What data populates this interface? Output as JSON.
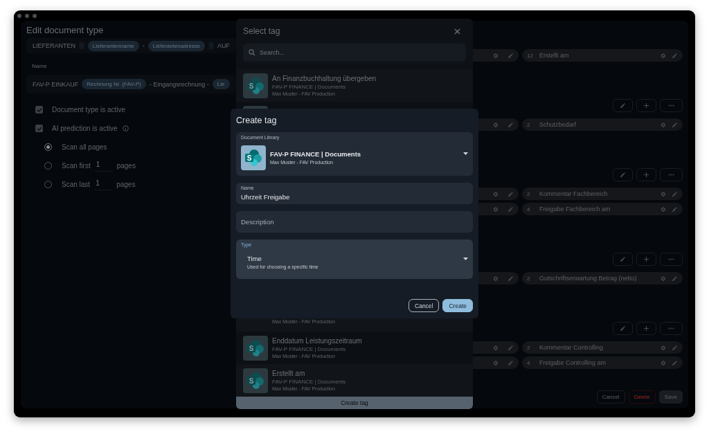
{
  "background": {
    "title": "Edit document type",
    "breadcrumb": [
      {
        "kind": "text",
        "text": "LIEFERANTEN"
      },
      {
        "kind": "chevron"
      },
      {
        "kind": "chip",
        "text": "Lieferantenname"
      },
      {
        "kind": "text",
        "text": "-"
      },
      {
        "kind": "chip",
        "text": "Lieferantenadresse"
      },
      {
        "kind": "chevron"
      },
      {
        "kind": "text",
        "text": "AUF"
      }
    ],
    "name_label": "Name",
    "name_parts": [
      {
        "kind": "text",
        "text": "FAV-P EINKAUF"
      },
      {
        "kind": "chip",
        "text": "Rechnung Nr. (FAV-P)"
      },
      {
        "kind": "text",
        "text": "- Eingangsrechnung -"
      },
      {
        "kind": "chip",
        "text": "Lie"
      }
    ],
    "checkboxes": [
      {
        "label": "Document type is active",
        "checked": true,
        "info": false
      },
      {
        "label": "AI prediction is active",
        "checked": true,
        "info": true
      }
    ],
    "scan_options": [
      {
        "label": "Scan all pages",
        "selected": true
      },
      {
        "label": "Scan first",
        "value": "1",
        "suffix": "pages",
        "selected": false
      },
      {
        "label": "Scan last",
        "value": "1",
        "suffix": "pages",
        "selected": false
      }
    ],
    "fields": [
      {
        "kind": "field",
        "number": "12",
        "label": "Erstellt am"
      },
      {
        "kind": "actions"
      },
      {
        "kind": "field",
        "number": "2",
        "label": "Schutzbedarf"
      },
      {
        "kind": "actions"
      },
      {
        "kind": "field",
        "number": "2",
        "label": "Kommentar Fachbereich"
      },
      {
        "kind": "field",
        "number": "4",
        "label": "Freigabe Fachbereich am"
      },
      {
        "kind": "actions"
      },
      {
        "kind": "field",
        "number": "2",
        "label": "Gutschriftserwartung Betrag (netto)"
      },
      {
        "kind": "actions"
      },
      {
        "kind": "field",
        "number": "2",
        "label": "Kommentar Controlling"
      },
      {
        "kind": "field",
        "number": "4",
        "label": "Freigabe Controlling am"
      }
    ],
    "footer_buttons": [
      {
        "kind": "outline",
        "label": "Cancel"
      },
      {
        "kind": "danger",
        "label": "Delete"
      },
      {
        "kind": "filled",
        "label": "Save"
      }
    ]
  },
  "select_tag": {
    "title": "Select tag",
    "search": {
      "placeholder": "Search..."
    },
    "top_items": [
      {
        "logo_letter": "S",
        "title": "An Finanzbuchhaltung übergeben",
        "library": "FAV-P FINANCE | Documents",
        "owner": "Max Muster - FAV Production"
      },
      {
        "kind": "partial"
      }
    ],
    "bottom_items": [
      {
        "owner": "Max Muster - FAV Production"
      },
      {
        "logo_letter": "S",
        "title": "Enddatum Leistungszeitraum",
        "library": "FAV-P FINANCE | Documents",
        "owner": "Max Muster - FAV Production"
      },
      {
        "logo_letter": "S",
        "title": "Erstellt am",
        "library": "FAV-P FINANCE | Documents",
        "owner": "Max Muster - FAV Production"
      }
    ],
    "create_button": "Create tag"
  },
  "create_tag": {
    "title": "Create tag",
    "library": {
      "label": "Document Library",
      "logo_letter": "S",
      "value": "FAV-P FINANCE | Documents",
      "owner": "Max Muster - FAV Production"
    },
    "name": {
      "label": "Name",
      "value": "Uhrzeit Freigabe"
    },
    "description": {
      "placeholder": "Description"
    },
    "type": {
      "label": "Type",
      "focused": true,
      "value": "Time",
      "hint": "Used for choosing a specific time"
    },
    "buttons": [
      {
        "kind": "outline",
        "label": "Cancel"
      },
      {
        "kind": "filled",
        "label": "Create"
      }
    ]
  }
}
